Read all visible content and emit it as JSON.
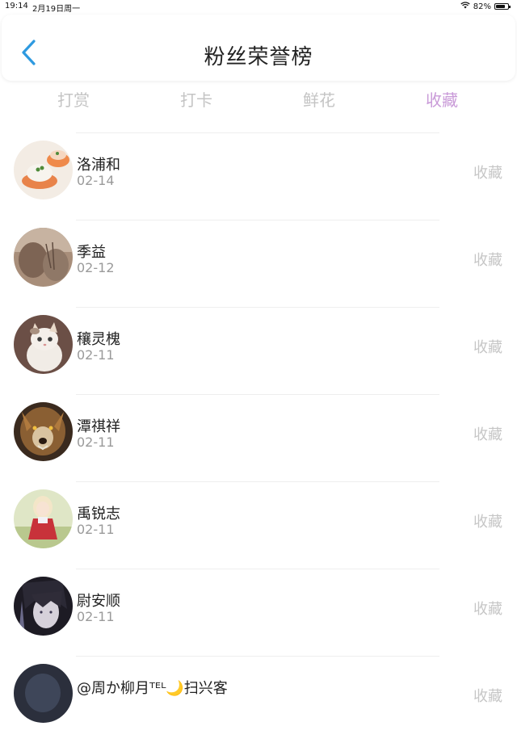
{
  "status_bar": {
    "time": "19:14",
    "date": "2月19日周一",
    "battery": "82%",
    "battery_level": 0.82
  },
  "header": {
    "title": "粉丝荣誉榜",
    "back_icon": "chevron-left-icon",
    "accent_color": "#2e9ae0"
  },
  "tabs": [
    {
      "label": "打赏",
      "active": false
    },
    {
      "label": "打卡",
      "active": false
    },
    {
      "label": "鲜花",
      "active": false
    },
    {
      "label": "收藏",
      "active": true
    }
  ],
  "colors": {
    "active_tab": "#c99ad8",
    "inactive_tab": "#c4c4c4"
  },
  "fans": [
    {
      "name": "洛浦和",
      "date": "02-14",
      "action": "收藏"
    },
    {
      "name": "季益",
      "date": "02-12",
      "action": "收藏"
    },
    {
      "name": "穰灵槐",
      "date": "02-11",
      "action": "收藏"
    },
    {
      "name": "潭祺祥",
      "date": "02-11",
      "action": "收藏"
    },
    {
      "name": "禹锐志",
      "date": "02-11",
      "action": "收藏"
    },
    {
      "name": "尉安顺",
      "date": "02-11",
      "action": "收藏"
    },
    {
      "name": "@周か柳月ᵀᴱᴸ🌙扫兴客",
      "date": "",
      "action": "收藏"
    }
  ]
}
